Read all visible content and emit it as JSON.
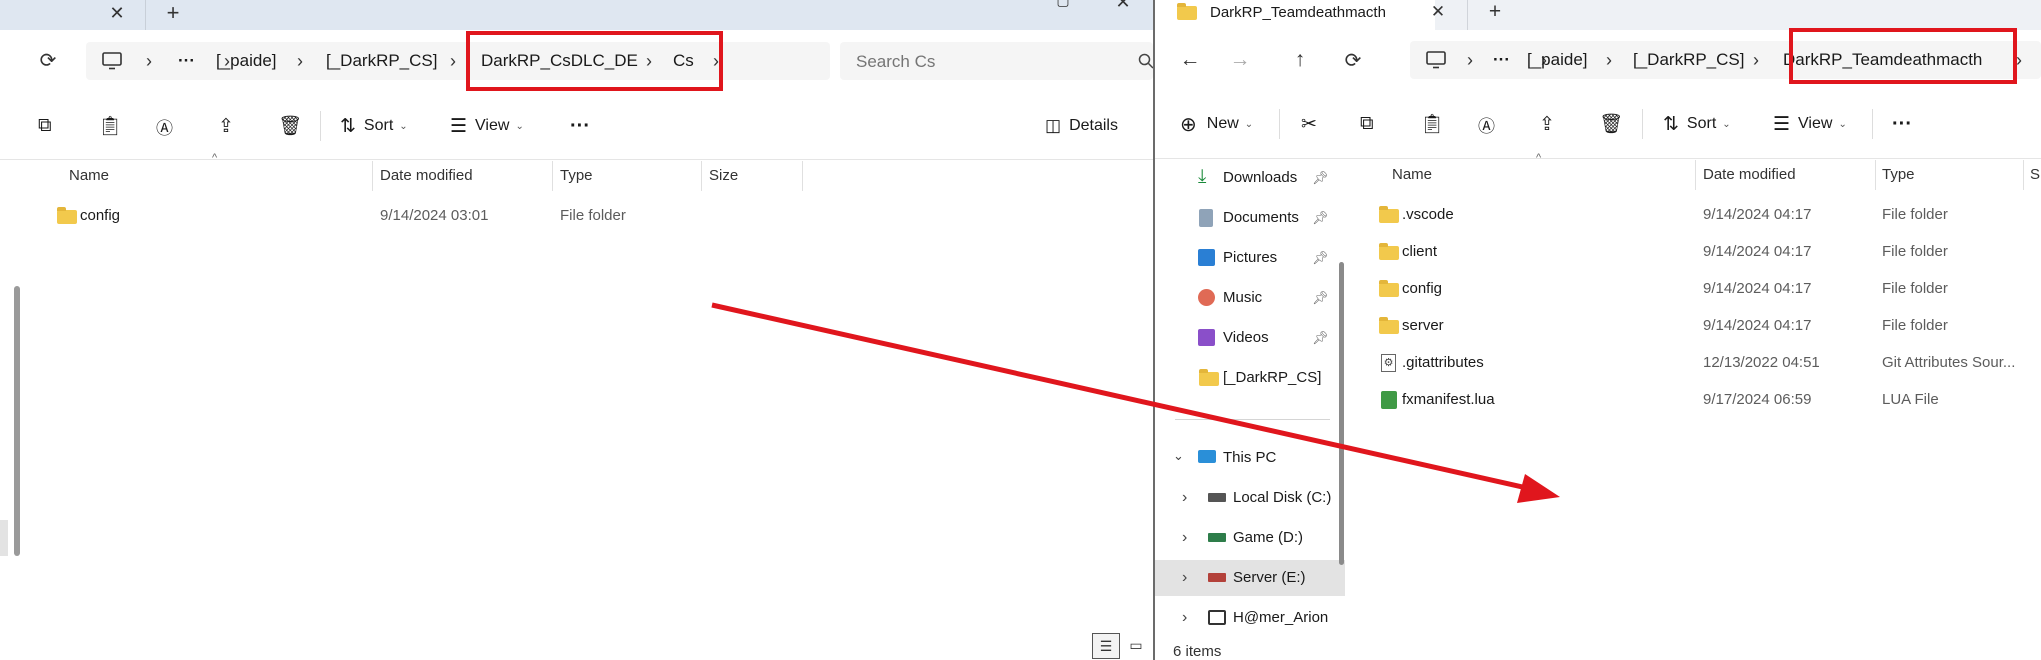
{
  "colors": {
    "highlight": "#e0161d",
    "arrow": "#e0161d",
    "folder": "#f2c94c",
    "selected_nav": "#e3e3e3"
  },
  "left_window": {
    "tab": {
      "close_icon": "close-icon",
      "new_tab_icon": "plus-icon"
    },
    "address": {
      "refresh_icon": "refresh-icon",
      "computer_icon": "computer-icon",
      "ellipsis": "···",
      "crumbs": [
        "[_paide]",
        "[_DarkRP_CS]",
        "DarkRP_CsDLC_DE",
        "Cs"
      ]
    },
    "search": {
      "placeholder": "Search Cs"
    },
    "toolbar": {
      "sort": "Sort",
      "view": "View",
      "more": "···",
      "details": "Details"
    },
    "columns": {
      "name": "Name",
      "date": "Date modified",
      "type": "Type",
      "size": "Size"
    },
    "files": [
      {
        "name": "config",
        "date": "9/14/2024 03:01",
        "type": "File folder"
      }
    ]
  },
  "right_window": {
    "tab": {
      "title": "DarkRP_Teamdeathmacth"
    },
    "address": {
      "ellipsis": "···",
      "crumbs": [
        "[_paide]",
        "[_DarkRP_CS]",
        "DarkRP_Teamdeathmacth"
      ]
    },
    "toolbar": {
      "new": "New",
      "sort": "Sort",
      "view": "View",
      "more": "···"
    },
    "nav": {
      "quick": [
        "Downloads",
        "Documents",
        "Pictures",
        "Music",
        "Videos",
        "[_DarkRP_CS]"
      ],
      "this_pc": "This PC",
      "drives": [
        "Local Disk (C:)",
        "Game (D:)",
        "Server (E:)",
        "H@mer_Arion"
      ]
    },
    "columns": {
      "name": "Name",
      "date": "Date modified",
      "type": "Type",
      "size": "S"
    },
    "files": [
      {
        "name": ".vscode",
        "date": "9/14/2024 04:17",
        "type": "File folder"
      },
      {
        "name": "client",
        "date": "9/14/2024 04:17",
        "type": "File folder"
      },
      {
        "name": "config",
        "date": "9/14/2024 04:17",
        "type": "File folder"
      },
      {
        "name": "server",
        "date": "9/14/2024 04:17",
        "type": "File folder"
      },
      {
        "name": ".gitattributes",
        "date": "12/13/2022 04:51",
        "type": "Git Attributes Sour..."
      },
      {
        "name": "fxmanifest.lua",
        "date": "9/17/2024 06:59",
        "type": "LUA File"
      }
    ],
    "status": {
      "items": "6 items"
    }
  }
}
